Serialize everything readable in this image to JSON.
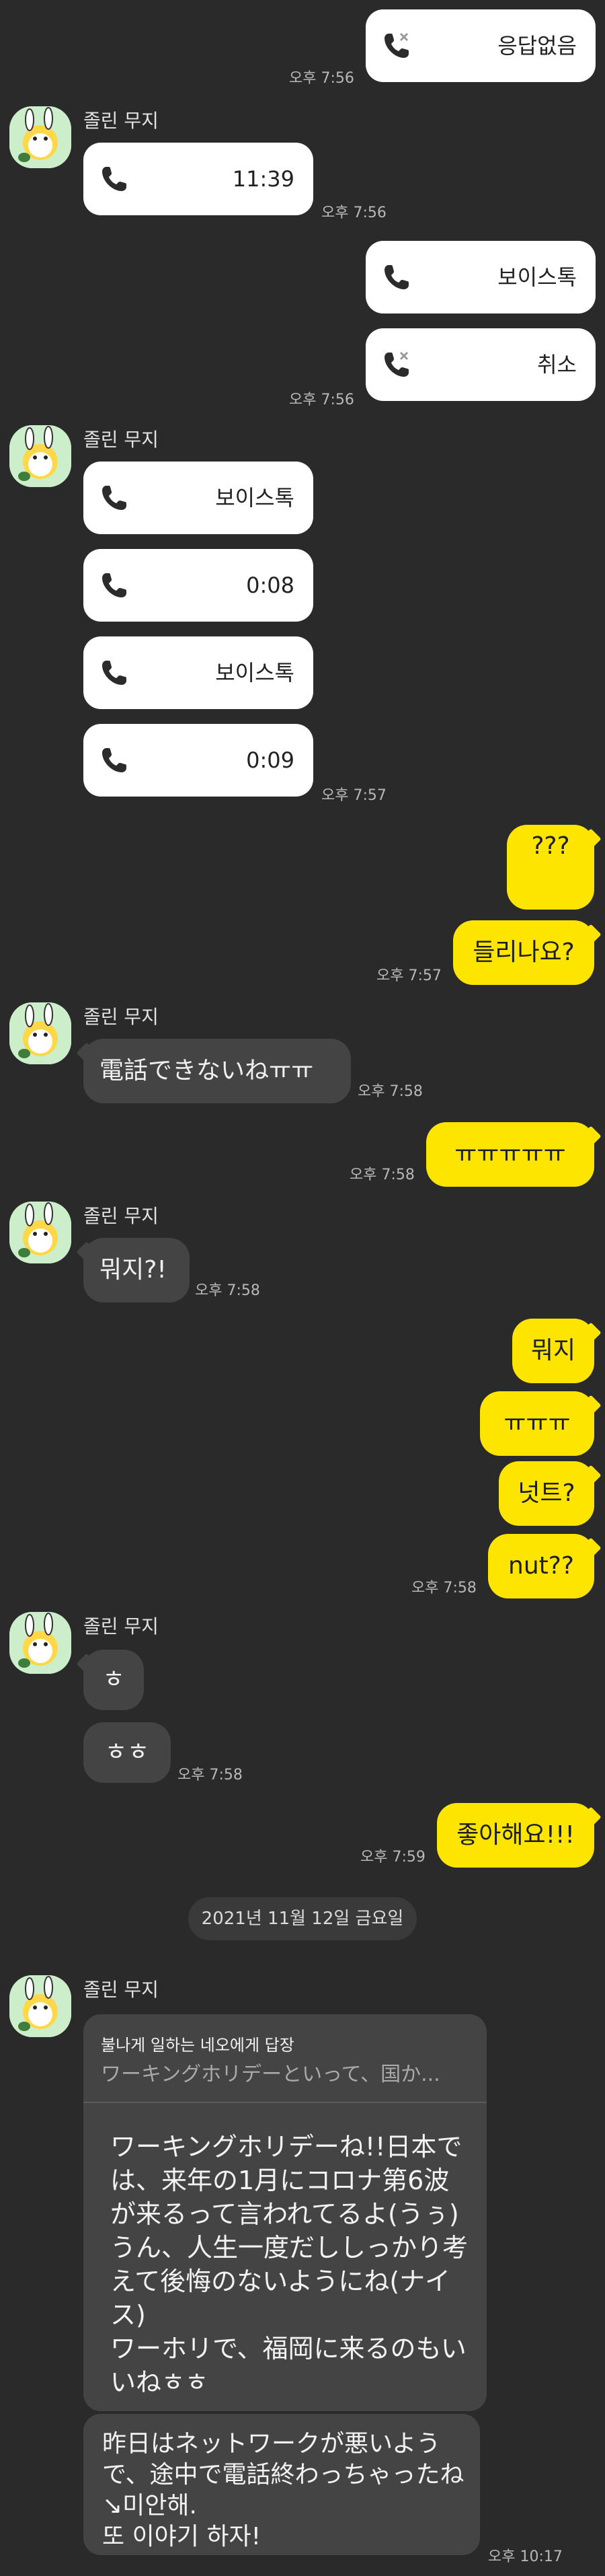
{
  "contact": {
    "name": "졸린 무지"
  },
  "colors": {
    "background": "#2a2a2a",
    "me_bubble": "#fee500",
    "other_bubble": "#444444",
    "call_bubble": "#ffffff"
  },
  "messages": {
    "call_no_answer": "응답없음",
    "time_0756_a": "오후 7:56",
    "call_duration_1": "11:39",
    "time_0756_b": "오후 7:56",
    "call_voicetalk_1": "보이스톡",
    "call_cancel": "취소",
    "time_0756_c": "오후 7:56",
    "call_voicetalk_2": "보이스톡",
    "call_duration_2": "0:08",
    "call_voicetalk_3": "보이스톡",
    "call_duration_3": "0:09",
    "time_0757_a": "오후 7:57",
    "me_qqq": "???",
    "me_hear": "들리나요?",
    "time_0757_b": "오후 7:57",
    "other_cant_call": "電話できないねㅠㅠ",
    "time_0758_a": "오후 7:58",
    "me_cry": "ㅠㅠㅠㅠㅠ",
    "time_0758_b": "오후 7:58",
    "other_what": "뭐지?!",
    "time_0758_c": "오후 7:58",
    "me_what": "뭐지",
    "me_cry2": "ㅠㅠㅠ",
    "me_nut_ko": "넛트?",
    "me_nut_en": "nut??",
    "time_0758_d": "오후 7:58",
    "other_o": "ㅎ",
    "other_oo": "ㅎㅎ",
    "time_0758_e": "오후 7:58",
    "me_good": "좋아해요!!!",
    "time_0759": "오후 7:59",
    "date_divider": "2021년 11월 12일 금요일",
    "reply_header": "불나게 일하는 네오에게 답장",
    "reply_quote": "ワーキングホリデーといって、国か...",
    "reply_body": "ワーキングホリデーね!!日本では、来年の1月にコロナ第6波が来るって言われてるよ(うぅ)うん、人生一度だししっかり考えて後悔のないようにね(ナイス)\nワーホリで、福岡に来るのもいいねㅎㅎ",
    "last_body": "昨日はネットワークが悪いようで、途中で電話終わっちゃったね↘미안해.\n또 이야기 하자!",
    "time_1017": "오후 10:17"
  }
}
